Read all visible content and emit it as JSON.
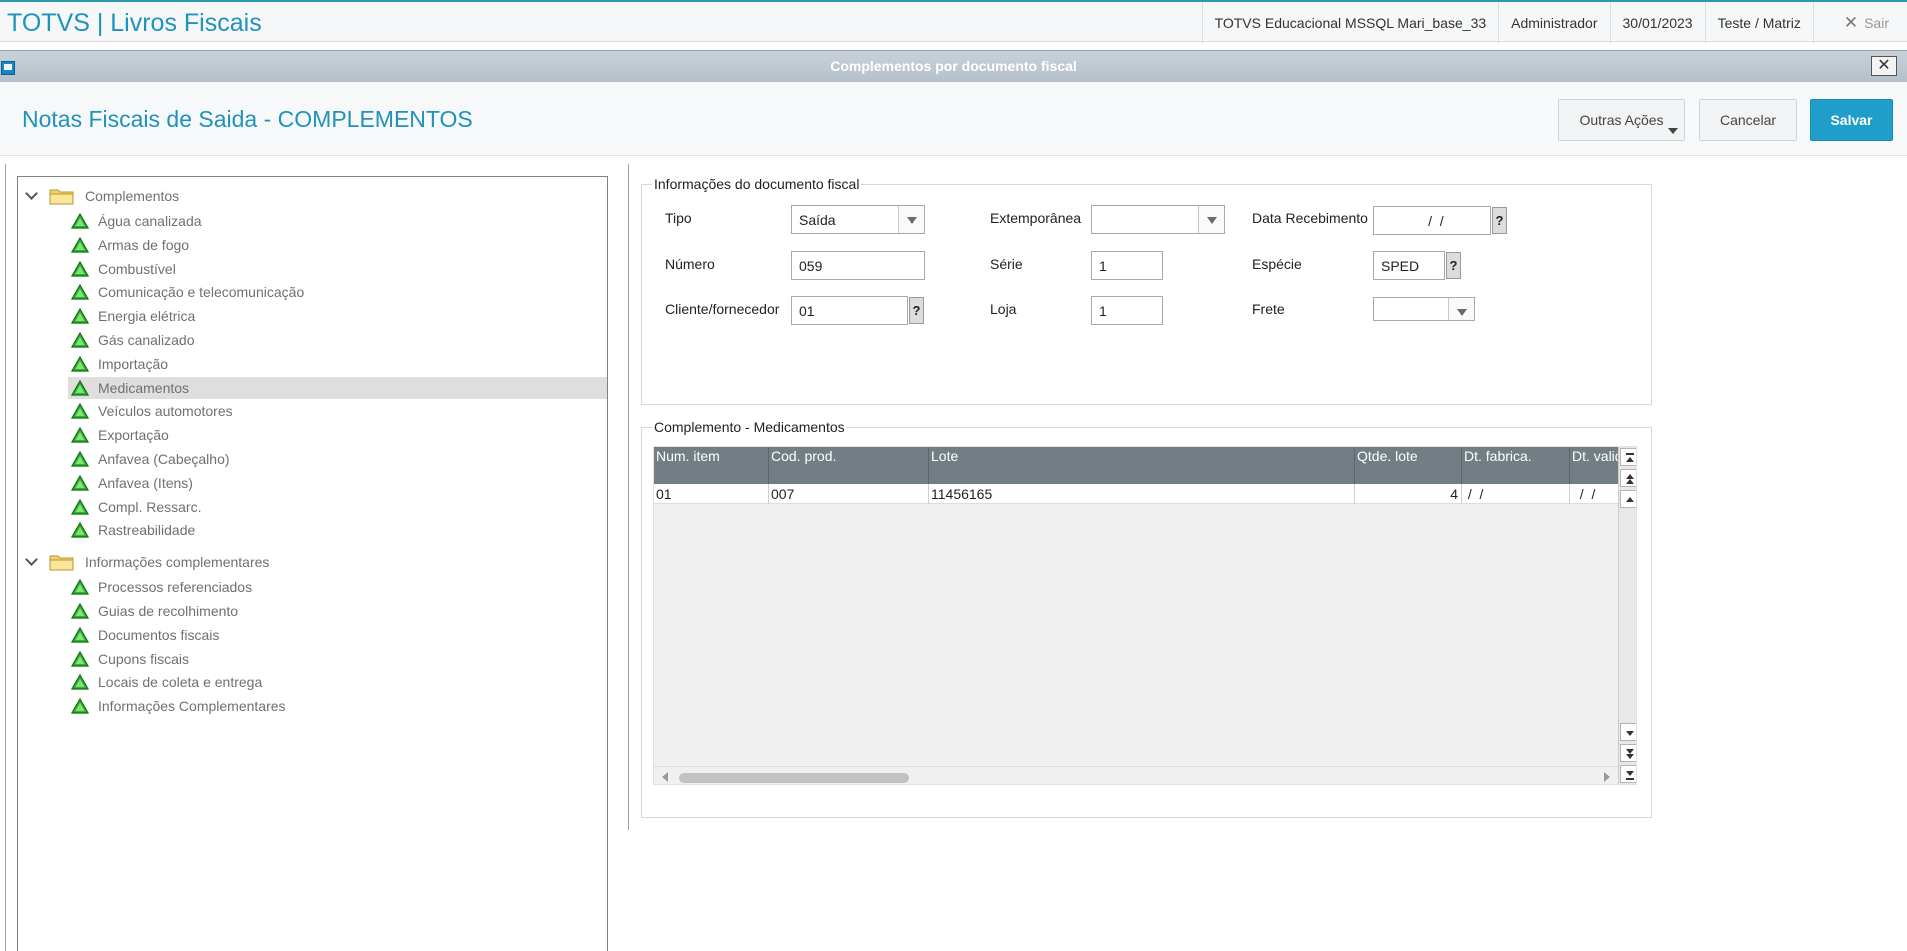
{
  "app": {
    "title": "TOTVS | Livros Fiscais",
    "environment": "TOTVS Educacional MSSQL Mari_base_33",
    "user": "Administrador",
    "date": "30/01/2023",
    "branch": "Teste / Matriz",
    "exit_label": "Sair"
  },
  "dialog": {
    "title": "Complementos por documento fiscal"
  },
  "header": {
    "page_title": "Notas Fiscais de Saida - COMPLEMENTOS",
    "other_actions": "Outras Ações",
    "cancel": "Cancelar",
    "save": "Salvar"
  },
  "tree": {
    "groups": [
      {
        "label": "Complementos",
        "items": [
          "Água canalizada",
          "Armas de fogo",
          "Combustível",
          "Comunicação e telecomunicação",
          "Energia elétrica",
          "Gás canalizado",
          "Importação",
          "Medicamentos",
          "Veículos automotores",
          "Exportação",
          "Anfavea (Cabeçalho)",
          "Anfavea (Itens)",
          "Compl. Ressarc.",
          "Rastreabilidade"
        ]
      },
      {
        "label": "Informações complementares",
        "items": [
          "Processos referenciados",
          "Guias de recolhimento",
          "Documentos fiscais",
          "Cupons fiscais",
          "Locais de coleta e entrega",
          "Informações Complementares"
        ]
      }
    ],
    "selected": "Medicamentos"
  },
  "doc_info": {
    "legend": "Informações do documento fiscal",
    "tipo": {
      "label": "Tipo",
      "value": "Saída"
    },
    "extemporanea": {
      "label": "Extemporânea",
      "value": ""
    },
    "data_recebimento": {
      "label": "Data Recebimento",
      "value": "  /  /"
    },
    "numero": {
      "label": "Número",
      "value": "059"
    },
    "serie": {
      "label": "Série",
      "value": "1"
    },
    "especie": {
      "label": "Espécie",
      "value": "SPED"
    },
    "cliente": {
      "label": "Cliente/fornecedor",
      "value": "01"
    },
    "loja": {
      "label": "Loja",
      "value": "1"
    },
    "frete": {
      "label": "Frete",
      "value": ""
    },
    "help_glyph": "?"
  },
  "complemento": {
    "legend": "Complemento - Medicamentos",
    "columns": [
      "Num. item",
      "Cod. prod.",
      "Lote",
      "Qtde. lote",
      "Dt. fabrica.",
      "Dt. valid"
    ],
    "rows": [
      [
        "01",
        "007",
        "11456165",
        "4",
        " /  /",
        "  /  /"
      ]
    ]
  }
}
